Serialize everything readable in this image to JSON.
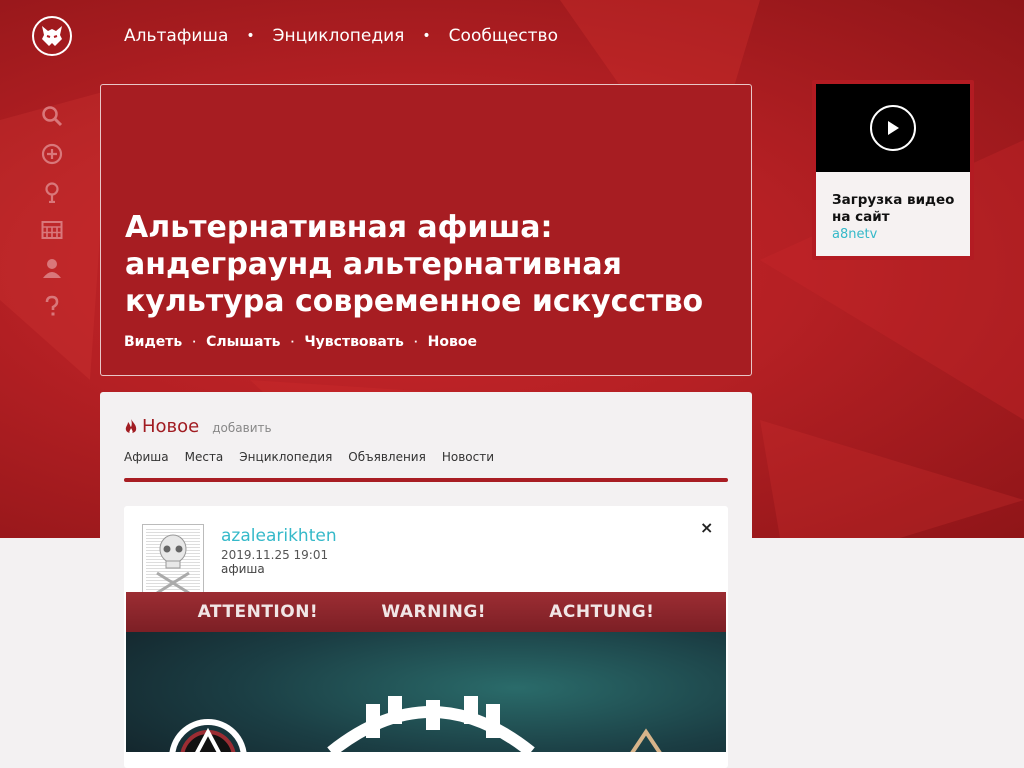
{
  "nav": {
    "items": [
      "Альтафиша",
      "Энциклопедия",
      "Сообщество"
    ],
    "separator": "•"
  },
  "sidebar_icons": [
    "search-icon",
    "add-circle-icon",
    "location-pin-icon",
    "calendar-icon",
    "user-icon",
    "help-icon"
  ],
  "hero": {
    "title": "Альтернативная афиша: андеграунд альтернативная культура современное искусство",
    "links": [
      "Видеть",
      "Слышать",
      "Чувствовать",
      "Новое"
    ],
    "separator": "·"
  },
  "video_widget": {
    "title": "Загрузка видео на сайт",
    "link": "a8netv"
  },
  "feed": {
    "title": "Новое",
    "add_label": "добавить",
    "tabs": [
      "Афиша",
      "Места",
      "Энциклопедия",
      "Объявления",
      "Новости"
    ]
  },
  "post": {
    "user": "azalearikhten",
    "date": "2019.11.25 19:01",
    "category": "афиша",
    "close": "×",
    "banner": [
      "ATTENTION!",
      "WARNING!",
      "ACHTUNG!"
    ]
  },
  "colors": {
    "brand_red": "#b31b22",
    "link_cyan": "#35b9c9",
    "page_bg": "#f3f1f2"
  }
}
